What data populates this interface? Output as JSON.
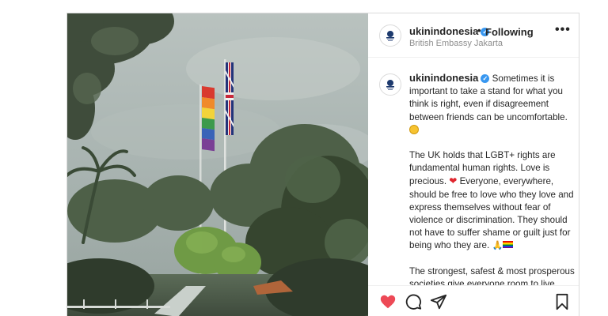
{
  "post": {
    "header": {
      "username": "ukinindonesia",
      "verified_mark": "✓",
      "separator": "•",
      "follow_status": "Following",
      "location": "British Embassy Jakarta",
      "more_label": "•••"
    },
    "caption": {
      "username": "ukinindonesia",
      "verified_mark": "✓",
      "paragraph1": "Sometimes it is important to take a stand for what you think is right, even if disagreement between friends can be uncomfortable.",
      "paragraph2_a": "The UK holds that LGBT+ rights are fundamental human rights. Love is precious.",
      "paragraph2_heart": "❤",
      "paragraph2_b": "Everyone, everywhere, should be free to love who they love and express themselves without fear of violence or discrimination. They should not have to suffer shame or guilt just for being who they are.",
      "paragraph2_pray": "🙏",
      "paragraph3": "The strongest, safest & most prosperous societies give everyone room to live freely as who they really are, without fear of violence or discrimination. So all"
    },
    "icons": {
      "avatar": "uk-government-crest-icon",
      "like": "heart-icon",
      "comment": "comment-bubble-icon",
      "share": "paper-plane-icon",
      "save": "bookmark-icon",
      "more": "more-options-icon"
    },
    "colors": {
      "like_active": "#ed4956",
      "verified": "#3897f0",
      "muted_text": "#8e8e8e"
    }
  }
}
